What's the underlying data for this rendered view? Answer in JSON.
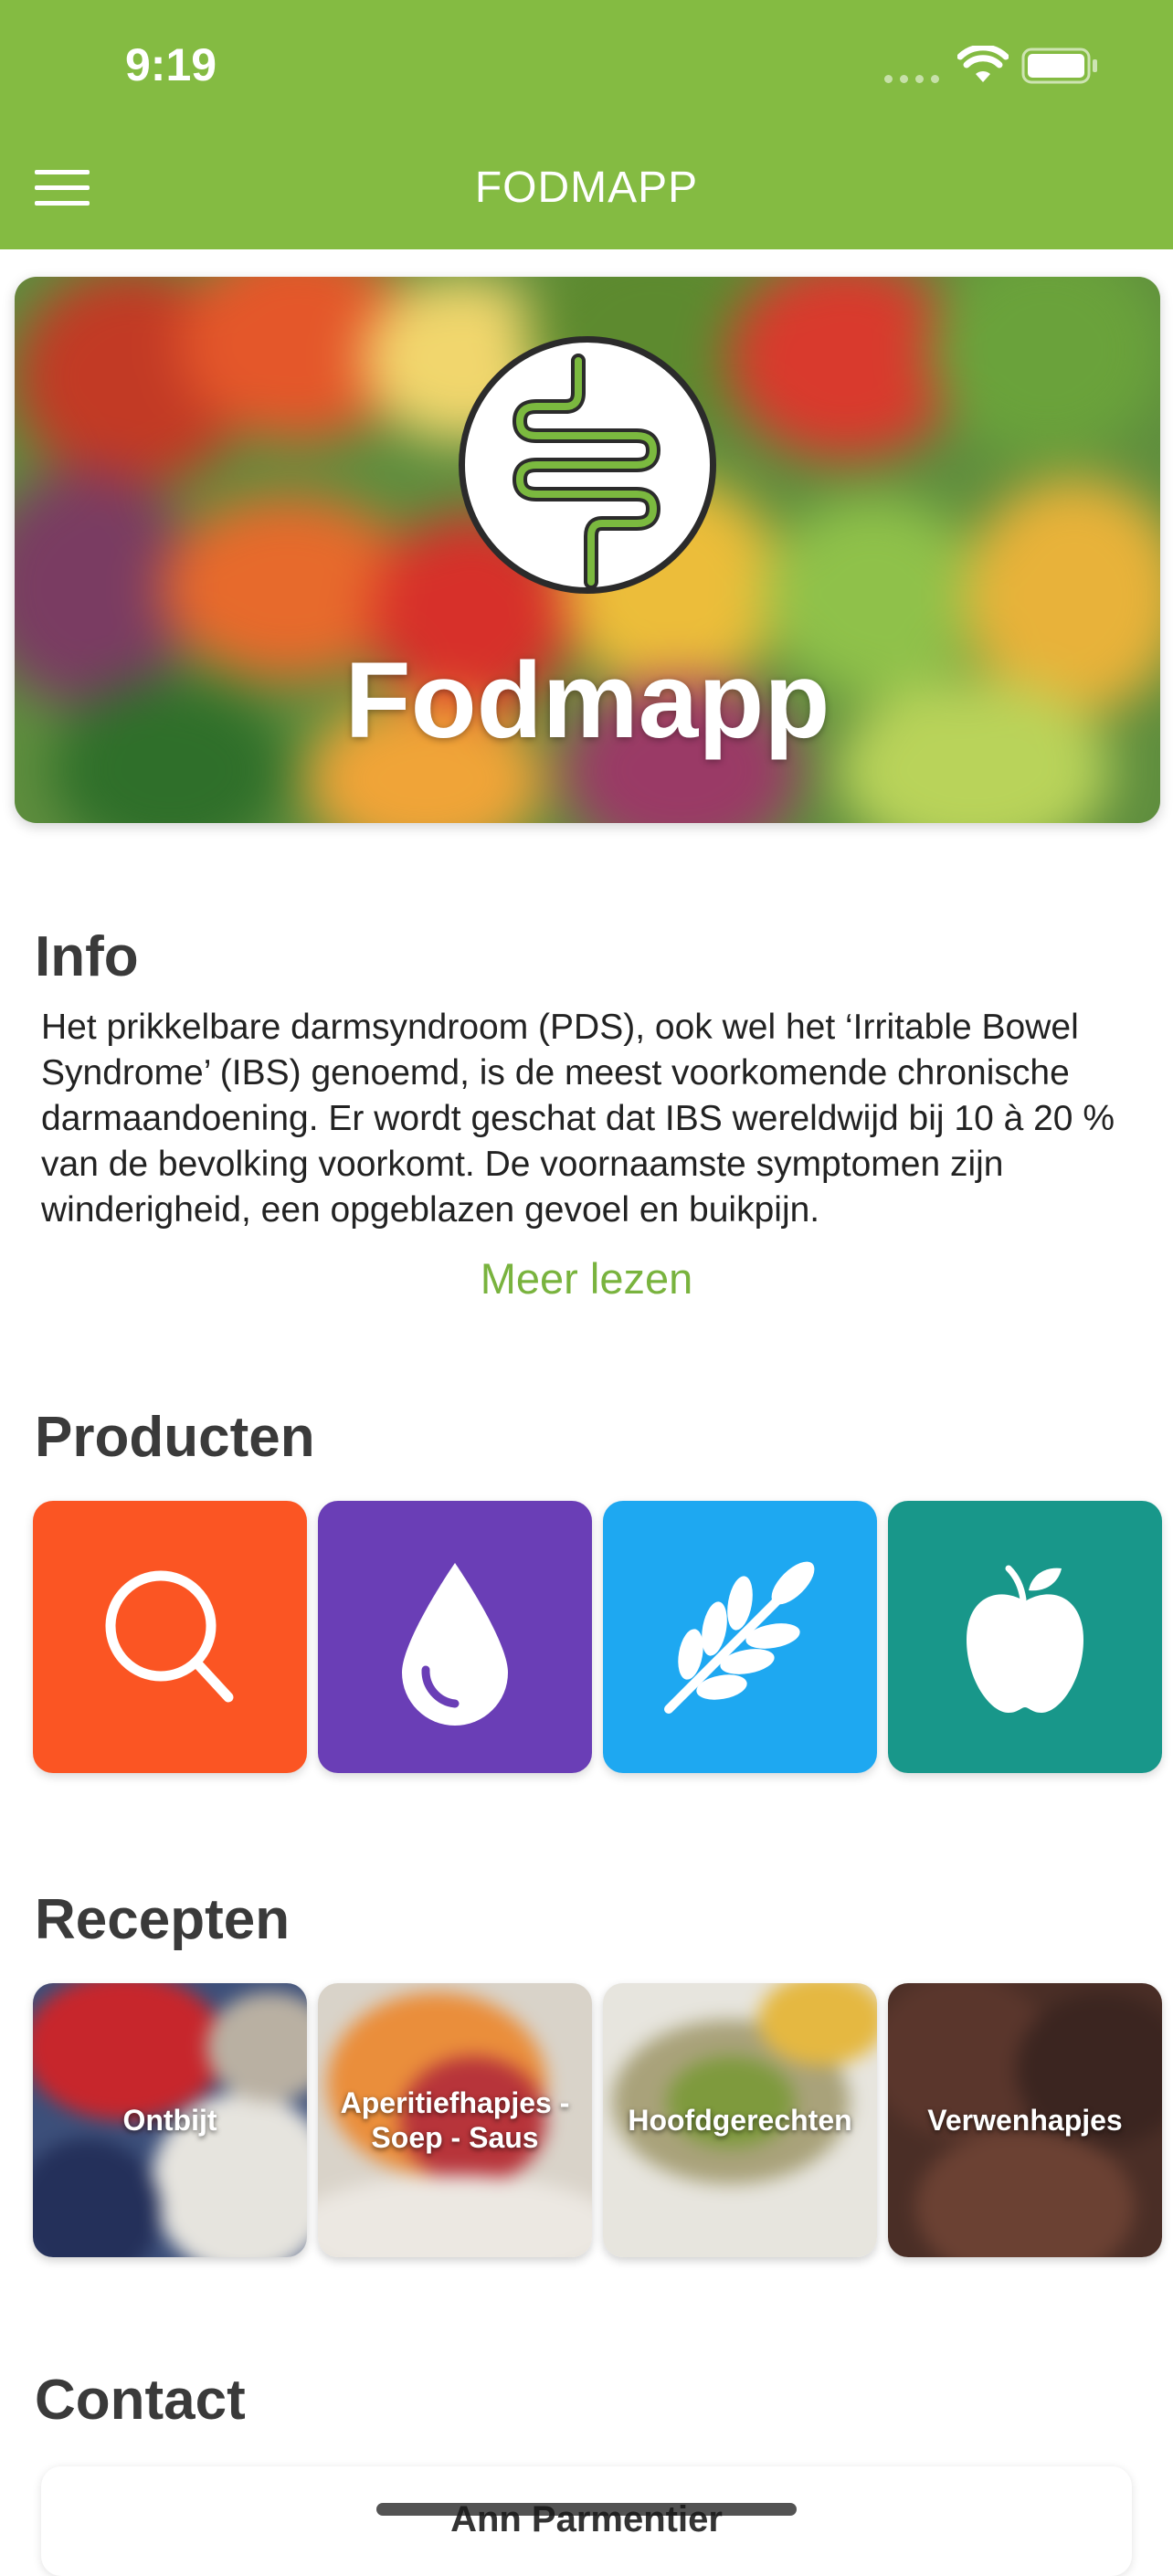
{
  "status_bar": {
    "time": "9:19"
  },
  "header": {
    "title": "FODMAPP"
  },
  "hero": {
    "title": "Fodmapp"
  },
  "info": {
    "heading": "Info",
    "text": "Het prikkelbare darmsyndroom (PDS), ook wel het ‘Irritable Bowel Syndrome’ (IBS) genoemd, is de meest voorkomende chronische darmaandoening. Er wordt geschat dat IBS wereldwijd bij 10 à 20 % van de bevolking voorkomt. De voornaamste symptomen zijn winderigheid, een opgeblazen gevoel en buikpijn.",
    "more_label": "Meer lezen"
  },
  "products": {
    "heading": "Producten",
    "tiles": [
      {
        "icon": "search-icon",
        "color": "#fb5523"
      },
      {
        "icon": "drop-icon",
        "color": "#6a3eb6"
      },
      {
        "icon": "wheat-icon",
        "color": "#1ea8f1"
      },
      {
        "icon": "apple-icon",
        "color": "#18978a"
      }
    ]
  },
  "recipes": {
    "heading": "Recepten",
    "items": [
      {
        "label": "Ontbijt"
      },
      {
        "label": "Aperitiefhapjes - Soep - Saus"
      },
      {
        "label": "Hoofdgerechten"
      },
      {
        "label": "Verwenhapjes"
      }
    ]
  },
  "contact": {
    "heading": "Contact",
    "name": "Ann Parmentier"
  },
  "colors": {
    "accent": "#84bb42",
    "link": "#79b33e"
  }
}
